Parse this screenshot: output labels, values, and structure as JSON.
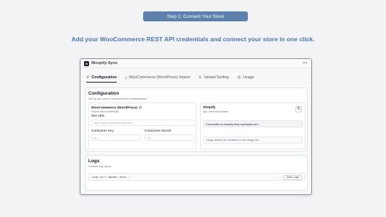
{
  "step": {
    "label": "Step 1: Connect Your Store"
  },
  "headline": "Add your WooCommerce REST API credentials and connect your store in one click.",
  "app": {
    "logo": "W",
    "title": "Woopify-Sync"
  },
  "tabs": [
    {
      "label": "Configuration",
      "icon": "gear-icon",
      "active": true
    },
    {
      "label": "WooCommerce (WordPress) Import",
      "icon": "download-icon"
    },
    {
      "label": "Variant Sorting",
      "icon": "sort-icon"
    },
    {
      "label": "Usage",
      "icon": "chart-icon"
    }
  ],
  "config": {
    "title": "Configuration",
    "subtitle": "Set up your store connections and authentication.",
    "woo": {
      "title": "WooCommerce (WordPress)",
      "subtitle": "Source store credentials",
      "site_url_label": "Site URL",
      "site_url_placeholder": "https://your-wordpress-site.com",
      "consumer_key_label": "Consumer Key",
      "consumer_key_placeholder": "ck_...",
      "consumer_secret_label": "Consumer Secret",
      "consumer_secret_placeholder": "cs_..."
    },
    "shopify": {
      "title": "Shopify",
      "subtitle": "App connection status",
      "status": "Connected to woopify-test.myshopify.com",
      "usage_note": "Usage details are available in the Usage tab."
    }
  },
  "logs": {
    "title": "Logs",
    "subtitle": "Console log output",
    "placeholder": "Logs will appear here...",
    "clear_label": "Clear Logs"
  },
  "colors": {
    "accent": "#5d80ad",
    "headline": "#4d74a8",
    "background": "#f1f3f7"
  }
}
